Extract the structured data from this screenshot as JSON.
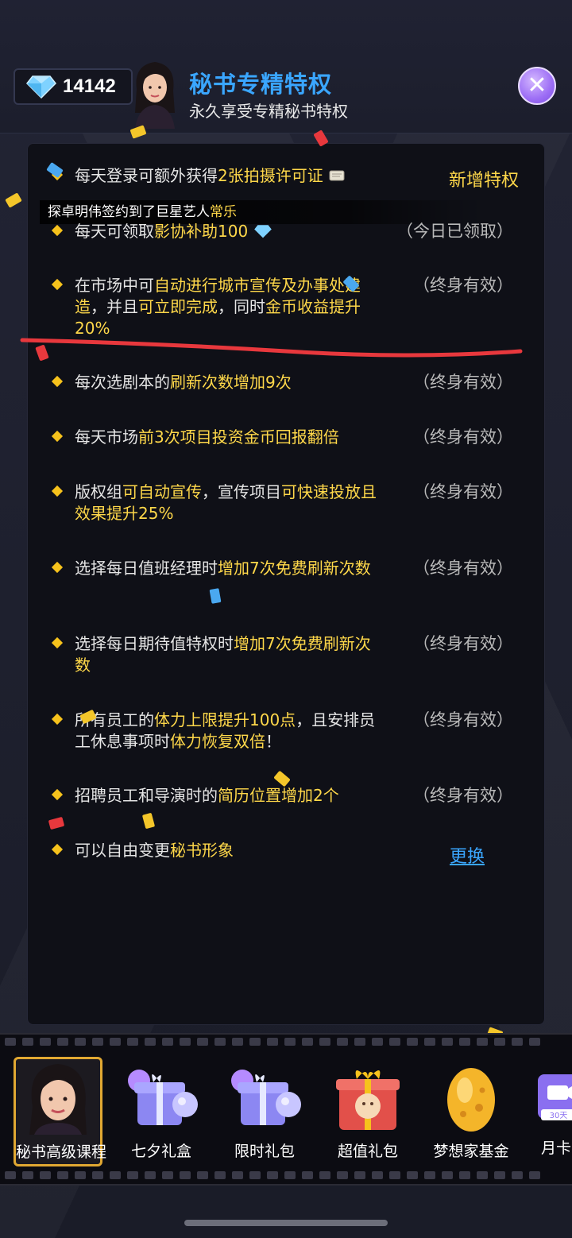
{
  "header": {
    "diamonds": "14142",
    "title": "秘书专精特权",
    "subtitle": "永久享受专精秘书特权",
    "close_label": "✕"
  },
  "panel": {
    "new_label": "新增特权",
    "notice": {
      "prefix": "探卓明伟签约到了巨星艺人",
      "highlight": "常乐"
    },
    "rows": [
      {
        "segments": [
          "每天登录可额外获得",
          "2张拍摄许可证",
          ""
        ],
        "status": ""
      },
      {
        "segments": [
          "每天可领取",
          "影协补助100",
          ""
        ],
        "status": "（今日已领取）"
      },
      {
        "segments": [
          "在市场中可",
          "自动进行城市宣传及办事处建造",
          "，并且",
          "可立即完成",
          "，同时",
          "金币收益提升20%"
        ],
        "status": "（终身有效）"
      },
      {
        "segments": [
          "每次选剧本的",
          "刷新次数增加9次",
          ""
        ],
        "status": "（终身有效）"
      },
      {
        "segments": [
          "每天市场",
          "前3次项目投资金币回报翻倍",
          ""
        ],
        "status": "（终身有效）"
      },
      {
        "segments": [
          "版权组",
          "可自动宣传",
          "，宣传项目",
          "可快速投放且效果提升25%"
        ],
        "status": "（终身有效）"
      },
      {
        "segments": [
          "选择每日值班经理时",
          "增加7次免费刷新次数",
          ""
        ],
        "status": "（终身有效）"
      },
      {
        "segments": [
          "选择每日期待值特权时",
          "增加7次免费刷新次数",
          ""
        ],
        "status": "（终身有效）"
      },
      {
        "segments": [
          "所有员工的",
          "体力上限提升100点",
          "，且安排员工休息事项时",
          "体力恢复双倍",
          "！"
        ],
        "status": "（终身有效）"
      },
      {
        "segments": [
          "招聘员工和导演时的",
          "简历位置增加2个",
          ""
        ],
        "status": "（终身有效）"
      },
      {
        "segments": [
          "可以自由变更",
          "秘书形象",
          ""
        ],
        "status": ""
      }
    ],
    "change_link": "更换"
  },
  "tabs": [
    {
      "label": "秘书高级课程",
      "icon": "secretary-avatar-icon"
    },
    {
      "label": "七夕礼盒",
      "icon": "gift-box-balloons-icon"
    },
    {
      "label": "限时礼包",
      "icon": "gift-box-balloons-icon"
    },
    {
      "label": "超值礼包",
      "icon": "red-gift-box-icon"
    },
    {
      "label": "梦想家基金",
      "icon": "golden-egg-icon"
    },
    {
      "label": "月卡",
      "icon": "month-card-icon",
      "badge": "30天"
    }
  ],
  "colors": {
    "accent_blue": "#3aa6ff",
    "highlight_yellow": "#ffd84a",
    "close_purple": "#9c6df5",
    "underline_red": "#e8383d"
  }
}
